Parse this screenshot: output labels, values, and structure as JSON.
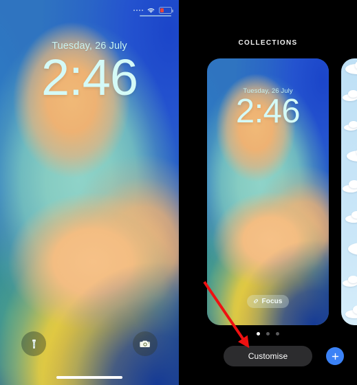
{
  "lockscreen": {
    "date": "Tuesday, 26 July",
    "time": "2:46",
    "status_bar": {
      "signal_icon": "signal-dots-icon",
      "wifi_icon": "wifi-icon",
      "battery_icon": "battery-low-icon",
      "battery_color": "#e8453c"
    },
    "flashlight_icon": "flashlight-icon",
    "camera_icon": "camera-icon",
    "home_indicator": "home-indicator"
  },
  "gallery": {
    "title": "COLLECTIONS",
    "cards": [
      {
        "name": "astronomy-abstract-wallpaper",
        "date": "Tuesday, 26 July",
        "time": "2:46",
        "focus_label": "Focus",
        "focus_icon": "focus-link-icon"
      },
      {
        "name": "clouds-wallpaper"
      }
    ],
    "pager": {
      "count": 3,
      "active_index": 0
    },
    "customise_label": "Customise",
    "add_icon": "plus-icon",
    "accent_color": "#3b82f6",
    "button_color": "#2c2c2e"
  },
  "annotation": {
    "arrow_color": "#ee1111",
    "arrow_target": "customise-button"
  }
}
